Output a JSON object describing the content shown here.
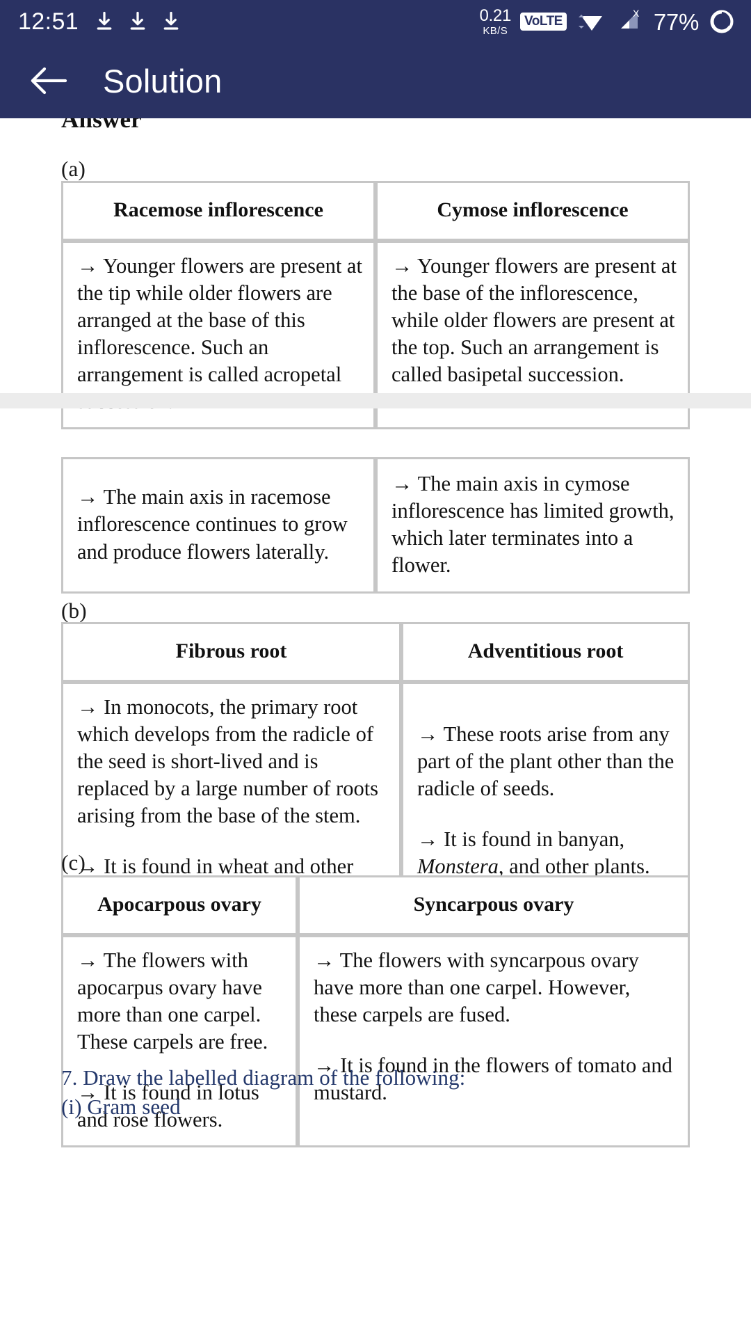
{
  "statusbar": {
    "clock": "12:51",
    "download_icons": [
      "download-icon",
      "download-icon",
      "download-icon"
    ],
    "network_speed_value": "0.21",
    "network_speed_unit": "KB/S",
    "volte_label": "VoLTE",
    "wifi_icon": "wifi-icon",
    "signal_icon": "signal-no-sim-icon",
    "signal_badge": "X",
    "battery_percent": "77%",
    "battery_icon": "battery-charging-icon",
    "background_color": "#2a3263"
  },
  "appbar": {
    "back_icon": "back-arrow-icon",
    "title": "Solution",
    "background_color": "#2a3263"
  },
  "document": {
    "clipped_heading": "Answer",
    "sections": [
      {
        "label": "(a)",
        "table": {
          "headers": [
            "Racemose inflorescence",
            "Cymose inflorescence"
          ],
          "rows": [
            {
              "left": "→ Younger flowers are present at the tip while older flowers are arranged at the base of this inflorescence. Such an arrangement is called acropetal succession.",
              "right": "→ Younger flowers are present at the base of the inflorescence, while older flowers are present at the top. Such an arrangement is called basipetal succession."
            }
          ]
        }
      },
      {
        "label": "",
        "table": {
          "headers": [],
          "rows": [
            {
              "left": "→ The main axis in racemose inflorescence continues to grow and produce flowers laterally.",
              "right": "→ The main axis in cymose inflorescence has limited growth, which later terminates into a flower."
            }
          ]
        }
      },
      {
        "label": "(b)",
        "table": {
          "headers": [
            "Fibrous root",
            "Adventitious root"
          ],
          "rows": [
            {
              "left_p1": "→ In monocots, the primary root which develops from the radicle of the seed is short-lived and is replaced by a large number of roots arising from the base of the stem.",
              "left_p2": "→ It is found in wheat and other cereals.",
              "right_p1": "→ These roots arise from any part of the plant other than the radicle of seeds.",
              "right_p2_a": "→ It is found in banyan, ",
              "right_p2_italic": "Monstera",
              "right_p2_b": ", and other plants."
            }
          ]
        }
      },
      {
        "label": "(c)",
        "table": {
          "headers": [
            "Apocarpous ovary",
            "Syncarpous ovary"
          ],
          "rows": [
            {
              "left_p1": "→ The flowers with apocarpus ovary have more than one carpel. These carpels are free.",
              "left_p2": "→ It is found in lotus and rose flowers.",
              "right_p1": "→ The flowers with syncarpous ovary have more than one carpel. However, these carpels are fused.",
              "right_p2": "→ It is found in the flowers of tomato and mustard."
            }
          ]
        }
      }
    ],
    "next_question": {
      "text": "7. Draw the labelled diagram of the following:",
      "subitem": "(i) Gram seed",
      "color": "#24386b"
    }
  }
}
